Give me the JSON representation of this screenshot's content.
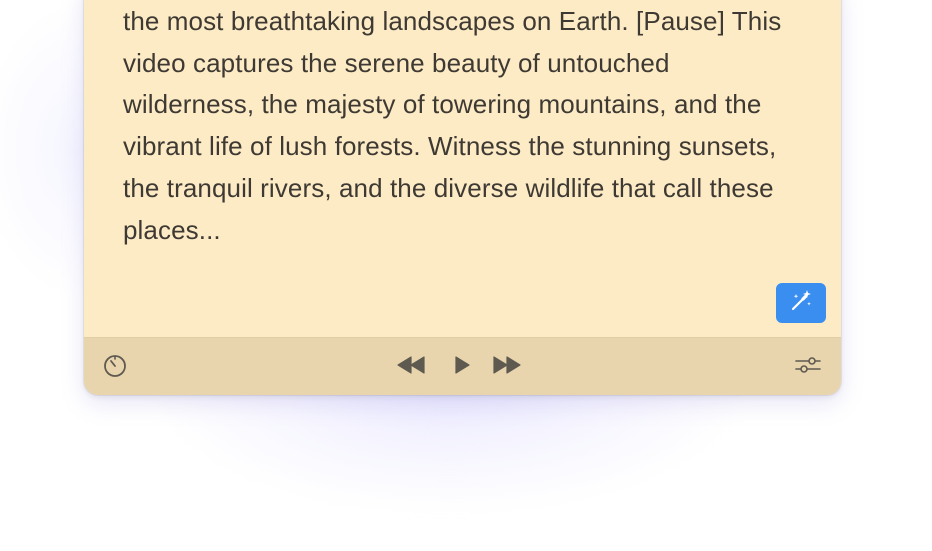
{
  "teleprompter": {
    "script_text": "the most breathtaking landscapes on Earth. [Pause] This video captures the serene beauty of untouched wilderness, the majesty of towering mountains, and the vibrant life of lush forests. Witness the stunning sunsets, the tranquil rivers, and the diverse wildlife that call these places...",
    "magic_button_icon": "magic-wand-icon",
    "magic_button_color": "#3a8ef0"
  },
  "controls": {
    "timer_icon": "timer-icon",
    "rewind_icon": "rewind-icon",
    "play_icon": "play-icon",
    "forward_icon": "fast-forward-icon",
    "settings_icon": "sliders-icon"
  },
  "colors": {
    "script_background": "#fdebc6",
    "controls_background": "#e8d5ad",
    "text": "#3e3a33",
    "icon": "#5f5a50"
  }
}
